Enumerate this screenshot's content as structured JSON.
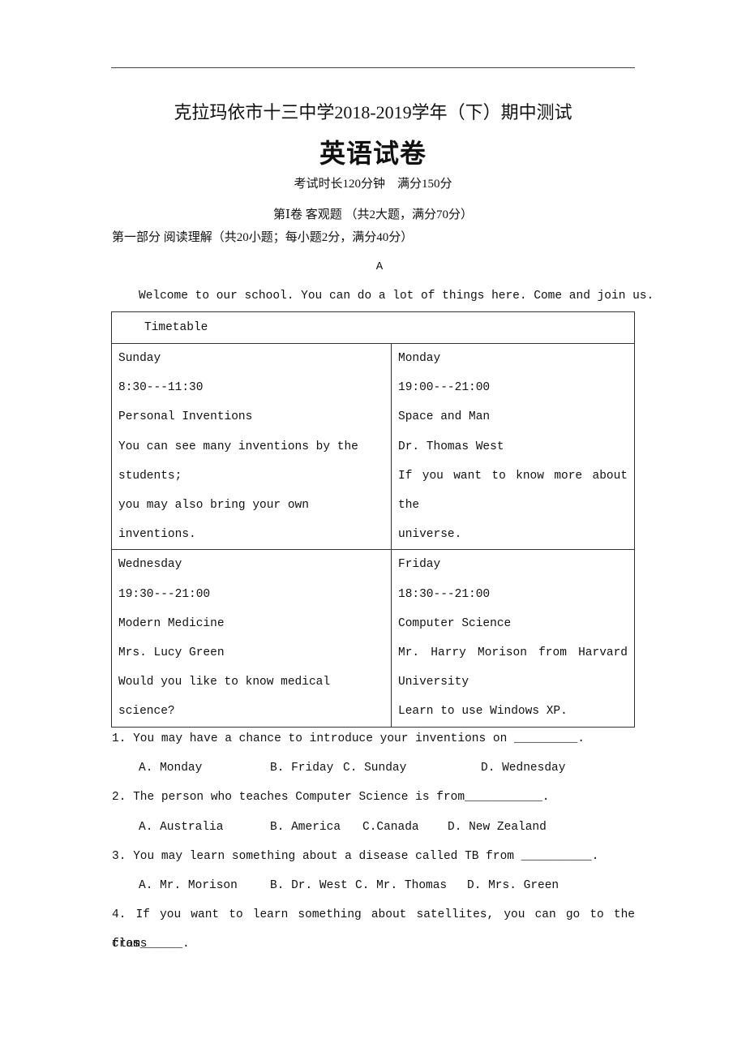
{
  "header": {
    "school_title": "克拉玛依市十三中学2018-2019学年（下）期中测试",
    "subject_title": "英语试卷",
    "exam_info": "考试时长120分钟　满分150分",
    "volume_title": "第Ⅰ卷 客观题 （共2大题，满分70分）",
    "part_title": "第一部分 阅读理解（共20小题；每小题2分，满分40分）"
  },
  "passage": {
    "label": "A",
    "intro": "Welcome to our school. You can do a lot of things here. Come and join us.",
    "timetable": {
      "title": "Timetable",
      "cells": [
        {
          "day": "Sunday",
          "time": "8:30---11:30",
          "course": "Personal Inventions",
          "lines": [
            "You can see many inventions by the",
            "students;",
            "you may also bring your own inventions."
          ]
        },
        {
          "day": "Monday",
          "time": "19:00---21:00",
          "course": "Space and Man",
          "lines": [
            "Dr. Thomas West",
            "If you want to know more about the",
            "universe."
          ]
        },
        {
          "day": "Wednesday",
          "time": "19:30---21:00",
          "course": "Modern Medicine",
          "lines": [
            "Mrs. Lucy Green",
            "Would you like to know medical science?"
          ]
        },
        {
          "day": "Friday",
          "time": "18:30---21:00",
          "course": "Computer Science",
          "lines": [
            "Mr. Harry Morison from Harvard",
            "University",
            "Learn to use Windows XP."
          ]
        }
      ]
    }
  },
  "questions": [
    {
      "text": "1. You may have a chance to introduce your inventions on _________.",
      "options": [
        "A. Monday",
        "B. Friday",
        "C. Sunday",
        "D. Wednesday"
      ]
    },
    {
      "text": "2. The person who teaches Computer Science is from___________.",
      "options": [
        "A. Australia",
        "B. America",
        "C.Canada",
        "D. New Zealand"
      ]
    },
    {
      "text": "3. You may learn something about a disease called TB from __________.",
      "options": [
        "A. Mr. Morison",
        "B. Dr. West",
        "C. Mr. Thomas",
        "D. Mrs. Green"
      ]
    },
    {
      "text_line1": "4. If you want to learn something about satellites, you can go to the class",
      "text_line2": "from______."
    }
  ]
}
